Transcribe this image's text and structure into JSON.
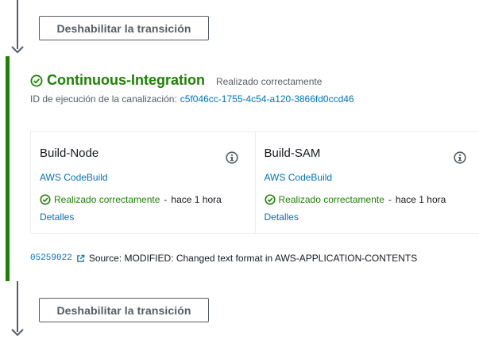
{
  "transitions": {
    "disable_label": "Deshabilitar la transición"
  },
  "stage": {
    "name": "Continuous-Integration",
    "status": "Realizado correctamente",
    "execution_id_label": "ID de ejecución de la canalización:",
    "execution_id": "c5f046cc-1755-4c54-a120-3866fd0ccd46",
    "status_color": "#1d8102",
    "actions": [
      {
        "name": "Build-Node",
        "provider": "AWS CodeBuild",
        "status": "Realizado correctamente",
        "separator": "-",
        "time": "hace 1 hora",
        "details_label": "Detalles"
      },
      {
        "name": "Build-SAM",
        "provider": "AWS CodeBuild",
        "status": "Realizado correctamente",
        "separator": "-",
        "time": "hace 1 hora",
        "details_label": "Detalles"
      }
    ],
    "source": {
      "commit_id": "05259022",
      "text": "Source: MODIFIED: Changed text format in AWS-APPLICATION-CONTENTS"
    }
  },
  "icons": {
    "success": "check-circle-icon",
    "info": "info-icon",
    "external": "external-link-icon",
    "arrow": "arrow-down-icon"
  },
  "colors": {
    "success": "#1d8102",
    "link": "#0073bb",
    "connector": "#545b64"
  }
}
